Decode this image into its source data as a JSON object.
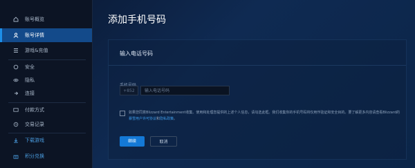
{
  "sidebar": {
    "items": [
      {
        "label": "账号概览",
        "icon": "home-icon"
      },
      {
        "label": "账号详情",
        "icon": "person-icon"
      },
      {
        "label": "游戏&充值",
        "icon": "list-icon"
      },
      {
        "label": "安全",
        "icon": "shield-icon"
      },
      {
        "label": "隐私",
        "icon": "eye-icon"
      },
      {
        "label": "连接",
        "icon": "link-icon"
      },
      {
        "label": "付款方式",
        "icon": "credit-card-icon"
      },
      {
        "label": "交易记录",
        "icon": "receipt-icon"
      },
      {
        "label": "下载游戏",
        "icon": "download-icon"
      },
      {
        "label": "积分兑换",
        "icon": "gift-icon"
      }
    ],
    "active_index": 1
  },
  "main": {
    "title": "添加手机号码",
    "panel_title": "输入电话号码",
    "field_label": "手机号码",
    "country_code": "+852",
    "phone_placeholder": "输入电话号码",
    "consent_text_1": "如果您同意Blizzard Entertainment收集、使用和处理您提供的上述个人信息，请勾选此框。我们收集你的手机号码将仅用作验证和安全目的。要了解更多内容请查看Blizzard的",
    "consent_link_1": "暴雪用户许可协议",
    "consent_text_2": "和",
    "consent_link_2": "隐私政策",
    "consent_text_3": "。",
    "continue_button": "继续",
    "cancel_button": "取消"
  },
  "colors": {
    "active_nav": "#134a8a",
    "primary_button": "#1479d6",
    "link": "#3d9be9"
  }
}
